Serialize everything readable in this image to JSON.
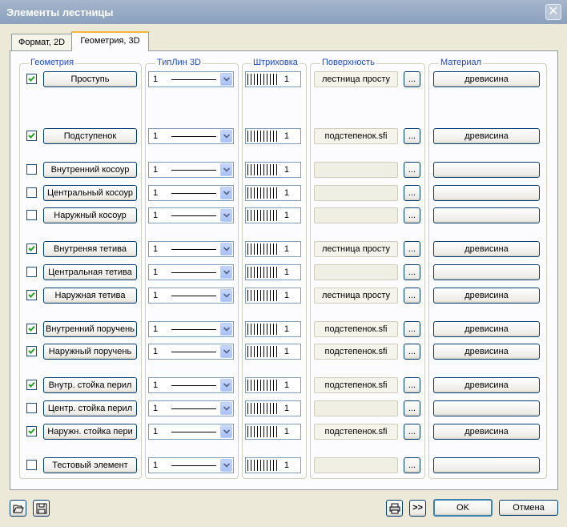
{
  "window": {
    "title": "Элементы лестницы",
    "close_glyph": "✕"
  },
  "tabs": [
    {
      "label": "Формат, 2D",
      "active": false
    },
    {
      "label": "Геометрия, 3D",
      "active": true
    }
  ],
  "columns": {
    "geometry": "Геометрия",
    "linetype": "ТипЛин 3D",
    "hatch": "Штриховка",
    "surface": "Поверхность",
    "material": "Материал"
  },
  "rows": [
    {
      "checked": true,
      "name": "Проступь",
      "linetype": "1",
      "hatch": "1",
      "surface": "лестница просту",
      "material": "древисина"
    },
    {
      "checked": true,
      "name": "Подступенок",
      "linetype": "1",
      "hatch": "1",
      "surface": "подстепенок.sfi",
      "material": "древисина"
    },
    {
      "checked": false,
      "name": "Внутренний косоур",
      "linetype": "1",
      "hatch": "1",
      "surface": "",
      "material": ""
    },
    {
      "checked": false,
      "name": "Центральный косоур",
      "linetype": "1",
      "hatch": "1",
      "surface": "",
      "material": ""
    },
    {
      "checked": false,
      "name": "Наружный косоур",
      "linetype": "1",
      "hatch": "1",
      "surface": "",
      "material": ""
    },
    {
      "checked": true,
      "name": "Внутреняя тетива",
      "linetype": "1",
      "hatch": "1",
      "surface": "лестница просту",
      "material": "древисина"
    },
    {
      "checked": false,
      "name": "Центральная тетива",
      "linetype": "1",
      "hatch": "1",
      "surface": "",
      "material": ""
    },
    {
      "checked": true,
      "name": "Наружная тетива",
      "linetype": "1",
      "hatch": "1",
      "surface": "лестница просту",
      "material": "древисина"
    },
    {
      "checked": true,
      "name": "Внутренний поручень",
      "linetype": "1",
      "hatch": "1",
      "surface": "подстепенок.sfi",
      "material": "древисина"
    },
    {
      "checked": true,
      "name": "Наружный поручень",
      "linetype": "1",
      "hatch": "1",
      "surface": "подстепенок.sfi",
      "material": "древисина"
    },
    {
      "checked": true,
      "name": "Внутр. стойка перил",
      "linetype": "1",
      "hatch": "1",
      "surface": "подстепенок.sfi",
      "material": "древисина"
    },
    {
      "checked": false,
      "name": "Центр. стойка перил",
      "linetype": "1",
      "hatch": "1",
      "surface": "",
      "material": ""
    },
    {
      "checked": true,
      "name": "Наружн. стойка пери",
      "linetype": "1",
      "hatch": "1",
      "surface": "подстепенок.sfi",
      "material": "древисина"
    },
    {
      "checked": false,
      "name": "Тестовый элемент",
      "linetype": "1",
      "hatch": "1",
      "surface": "",
      "material": ""
    }
  ],
  "browse_label": "...",
  "footer": {
    "expand_label": ">>",
    "ok_label": "OK",
    "cancel_label": "Отмена"
  },
  "icons": {
    "open": "folder-open-icon",
    "save": "floppy-disk-icon",
    "print": "printer-icon",
    "checkbox": "check-mark-icon",
    "dropdown": "chevron-down-icon"
  },
  "colors": {
    "group_title": "#1f4ac6",
    "checkmark": "#21a121",
    "tab_highlight": "#f8b33b",
    "button_border": "#003c74"
  }
}
